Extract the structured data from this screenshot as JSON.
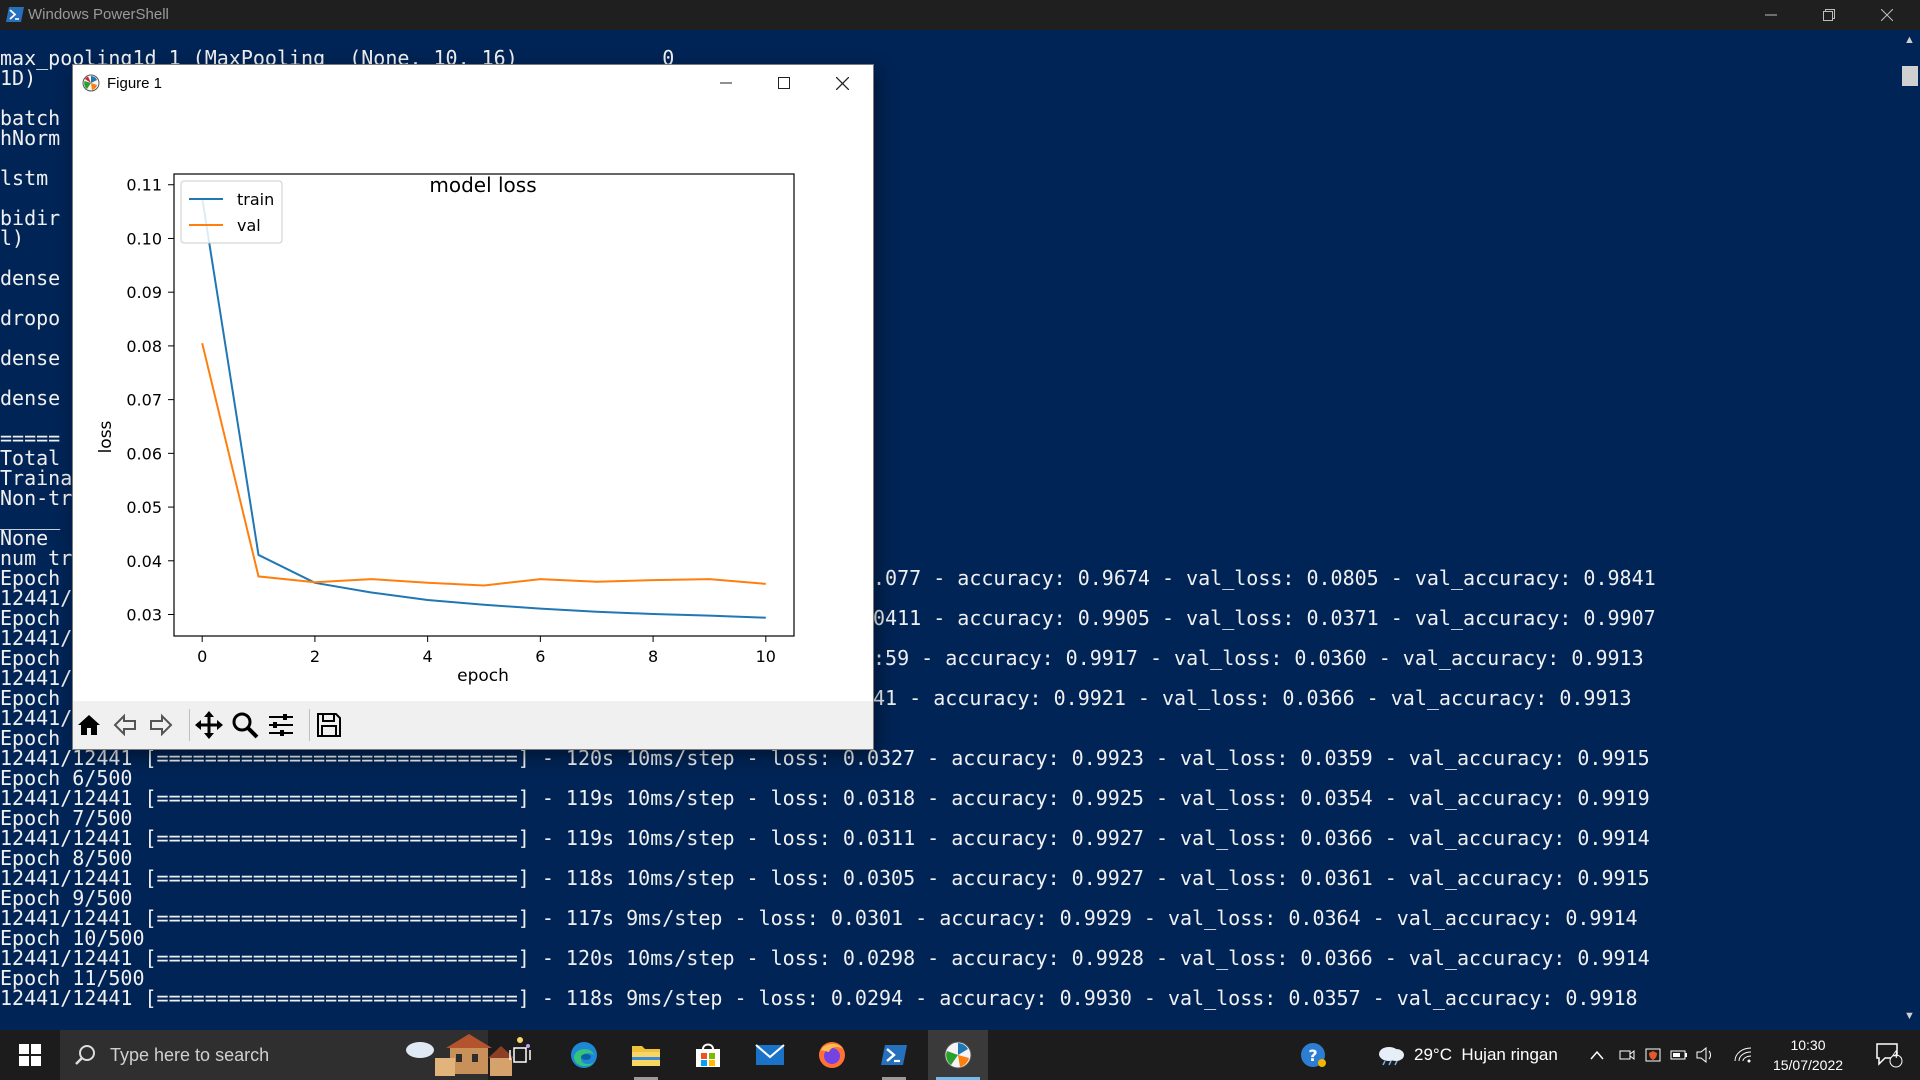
{
  "powershell": {
    "title": "Windows PowerShell",
    "lines": [
      "max_pooling1d_1 (MaxPooling  (None, 10, 16)            0",
      "1D)",
      "",
      "batch",
      "hNorm",
      "",
      "lstm",
      "",
      "bidir",
      "l)",
      "",
      "dense",
      "",
      "dropo",
      "",
      "dense",
      "",
      "dense",
      "",
      "=====",
      "Total",
      "Traina",
      "Non-tr",
      "_____",
      "None",
      "num tr",
      "Epoch",
      "12441/",
      "Epoch",
      "12441/",
      "Epoch",
      "12441/",
      "Epoch",
      "12441/",
      "Epoch",
      "12441/12441 [==============================] - 120s 10ms/step - loss: 0.0327 - accuracy: 0.9923 - val_loss: 0.0359 - val_accuracy: 0.9915",
      "Epoch 6/500",
      "12441/12441 [==============================] - 119s 10ms/step - loss: 0.0318 - accuracy: 0.9925 - val_loss: 0.0354 - val_accuracy: 0.9919",
      "Epoch 7/500",
      "12441/12441 [==============================] - 119s 10ms/step - loss: 0.0311 - accuracy: 0.9927 - val_loss: 0.0366 - val_accuracy: 0.9914",
      "Epoch 8/500",
      "12441/12441 [==============================] - 118s 10ms/step - loss: 0.0305 - accuracy: 0.9927 - val_loss: 0.0361 - val_accuracy: 0.9915",
      "Epoch 9/500",
      "12441/12441 [==============================] - 117s 9ms/step - loss: 0.0301 - accuracy: 0.9929 - val_loss: 0.0364 - val_accuracy: 0.9914",
      "Epoch 10/500",
      "12441/12441 [==============================] - 120s 10ms/step - loss: 0.0298 - accuracy: 0.9928 - val_loss: 0.0366 - val_accuracy: 0.9914",
      "Epoch 11/500",
      "12441/12441 [==============================] - 118s 9ms/step - loss: 0.0294 - accuracy: 0.9930 - val_loss: 0.0357 - val_accuracy: 0.9918"
    ],
    "right_fragments": [
      ".077 - accuracy: 0.9674 - val_loss: 0.0805 - val_accuracy: 0.9841",
      "0411 - accuracy: 0.9905 - val_loss: 0.0371 - val_accuracy: 0.9907",
      ":59 - accuracy: 0.9917 - val_loss: 0.0360 - val_accuracy: 0.9913",
      "41 - accuracy: 0.9921 - val_loss: 0.0366 - val_accuracy: 0.9913"
    ]
  },
  "figure": {
    "title": "Figure 1",
    "toolbar": [
      "home-icon",
      "back-arrow-icon",
      "forward-arrow-icon",
      "pan-icon",
      "zoom-icon",
      "configure-subplots-icon",
      "save-icon"
    ]
  },
  "chart_data": {
    "type": "line",
    "title": "model loss",
    "xlabel": "epoch",
    "ylabel": "loss",
    "x": [
      0,
      1,
      2,
      3,
      4,
      5,
      6,
      7,
      8,
      9,
      10
    ],
    "series": [
      {
        "name": "train",
        "color": "#1f77b4",
        "values": [
          0.1075,
          0.0411,
          0.0359,
          0.0341,
          0.0327,
          0.0318,
          0.0311,
          0.0305,
          0.0301,
          0.0298,
          0.0294
        ]
      },
      {
        "name": "val",
        "color": "#ff7f0e",
        "values": [
          0.0805,
          0.0371,
          0.036,
          0.0366,
          0.0359,
          0.0354,
          0.0366,
          0.0361,
          0.0364,
          0.0366,
          0.0357
        ]
      }
    ],
    "xlim": [
      -0.5,
      10.5
    ],
    "ylim": [
      0.026,
      0.112
    ],
    "xticks": [
      0,
      2,
      4,
      6,
      8,
      10
    ],
    "yticks": [
      0.03,
      0.04,
      0.05,
      0.06,
      0.07,
      0.08,
      0.09,
      0.1,
      0.11
    ],
    "ytick_labels": [
      "0.03",
      "0.04",
      "0.05",
      "0.06",
      "0.07",
      "0.08",
      "0.09",
      "0.10",
      "0.11"
    ],
    "legend": "upper left",
    "grid": false
  },
  "taskbar": {
    "search_placeholder": "Type here to search",
    "weather": "29°C  Hujan ringan",
    "time": "10:30",
    "date": "15/07/2022",
    "notification_count": "4"
  }
}
